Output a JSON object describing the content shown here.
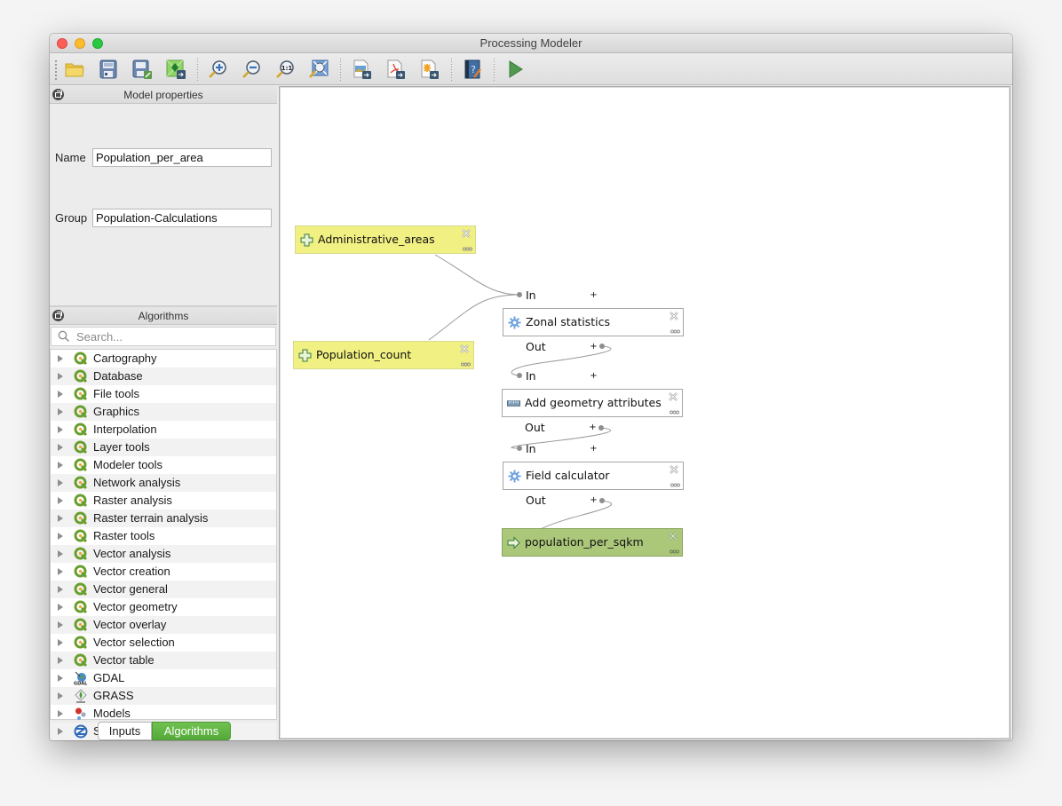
{
  "window": {
    "title": "Processing Modeler"
  },
  "toolbar": {
    "buttons": [
      {
        "name": "open-model",
        "icon": "folder-icon"
      },
      {
        "name": "save-model",
        "icon": "save-icon"
      },
      {
        "name": "save-model-as",
        "icon": "save-as-icon"
      },
      {
        "name": "save-to-project",
        "icon": "export-to-project-icon"
      },
      {
        "name": "zoom-in",
        "icon": "zoom-in-icon"
      },
      {
        "name": "zoom-out",
        "icon": "zoom-out-icon"
      },
      {
        "name": "zoom-actual",
        "icon": "zoom-actual-size-icon",
        "text": "1:1"
      },
      {
        "name": "zoom-full",
        "icon": "zoom-full-extent-icon"
      },
      {
        "name": "export-image",
        "icon": "export-image-icon"
      },
      {
        "name": "export-pdf",
        "icon": "export-pdf-icon"
      },
      {
        "name": "export-svg",
        "icon": "export-svg-icon"
      },
      {
        "name": "edit-help",
        "icon": "help-edit-icon",
        "text": "?"
      },
      {
        "name": "run-model",
        "icon": "run-icon"
      }
    ]
  },
  "model_properties": {
    "title": "Model properties",
    "name_label": "Name",
    "name_value": "Population_per_area",
    "group_label": "Group",
    "group_value": "Population-Calculations"
  },
  "algorithms_panel": {
    "title": "Algorithms",
    "search_placeholder": "Search...",
    "items": [
      {
        "label": "Cartography",
        "icon": "qgis-icon"
      },
      {
        "label": "Database",
        "icon": "qgis-icon"
      },
      {
        "label": "File tools",
        "icon": "qgis-icon"
      },
      {
        "label": "Graphics",
        "icon": "qgis-icon"
      },
      {
        "label": "Interpolation",
        "icon": "qgis-icon"
      },
      {
        "label": "Layer tools",
        "icon": "qgis-icon"
      },
      {
        "label": "Modeler tools",
        "icon": "qgis-icon"
      },
      {
        "label": "Network analysis",
        "icon": "qgis-icon"
      },
      {
        "label": "Raster analysis",
        "icon": "qgis-icon"
      },
      {
        "label": "Raster terrain analysis",
        "icon": "qgis-icon"
      },
      {
        "label": "Raster tools",
        "icon": "qgis-icon"
      },
      {
        "label": "Vector analysis",
        "icon": "qgis-icon"
      },
      {
        "label": "Vector creation",
        "icon": "qgis-icon"
      },
      {
        "label": "Vector general",
        "icon": "qgis-icon"
      },
      {
        "label": "Vector geometry",
        "icon": "qgis-icon"
      },
      {
        "label": "Vector overlay",
        "icon": "qgis-icon"
      },
      {
        "label": "Vector selection",
        "icon": "qgis-icon"
      },
      {
        "label": "Vector table",
        "icon": "qgis-icon"
      },
      {
        "label": "GDAL",
        "icon": "gdal-icon"
      },
      {
        "label": "GRASS",
        "icon": "grass-icon"
      },
      {
        "label": "Models",
        "icon": "models-icon"
      },
      {
        "label": "SAGA",
        "icon": "saga-icon"
      }
    ],
    "tabs": [
      {
        "label": "Inputs",
        "active": false
      },
      {
        "label": "Algorithms",
        "active": true
      }
    ]
  },
  "canvas": {
    "inputs": [
      {
        "label": "Administrative_areas"
      },
      {
        "label": "Population_count"
      }
    ],
    "algorithms": [
      {
        "label": "Zonal statistics",
        "in_label": "In",
        "out_label": "Out",
        "icon": "gear-icon"
      },
      {
        "label": "Add geometry attributes",
        "in_label": "In",
        "out_label": "Out",
        "icon": "ruler-icon"
      },
      {
        "label": "Field calculator",
        "in_label": "In",
        "out_label": "Out",
        "icon": "gear-icon"
      }
    ],
    "outputs": [
      {
        "label": "population_per_sqkm"
      }
    ],
    "colors": {
      "input_fill": "#f0f083",
      "output_fill": "#abc77a",
      "algorithm_fill": "#ffffff",
      "link": "#9a9a9a"
    }
  }
}
